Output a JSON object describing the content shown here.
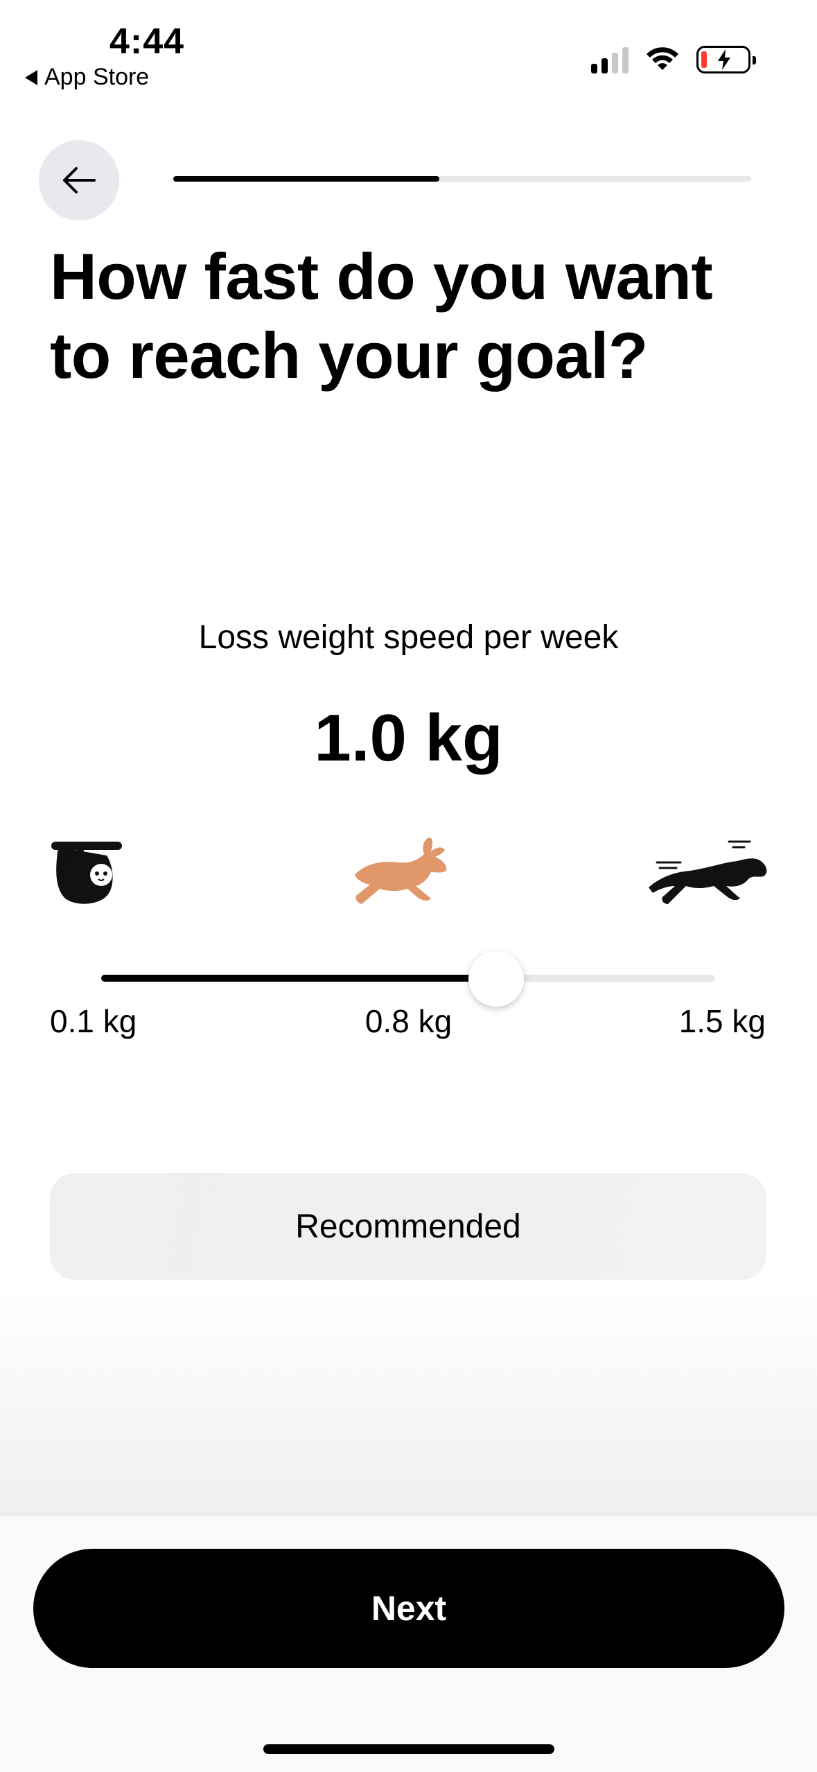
{
  "status_bar": {
    "time": "4:44",
    "back_app": "App Store",
    "battery_level_color": "#ff3b30"
  },
  "header": {
    "back_icon": "arrow-left-icon",
    "progress_fraction": 0.46
  },
  "question": {
    "title": "How fast do you want to reach your goal?",
    "subtitle": "Loss weight speed per week",
    "value": "1.0 kg"
  },
  "speed_slider": {
    "min": 0.1,
    "max": 1.5,
    "value": 1.0,
    "min_label": "0.1 kg",
    "mid_label": "0.8 kg",
    "max_label": "1.5 kg",
    "icons": [
      "sloth-icon",
      "rabbit-icon",
      "panther-icon"
    ],
    "highlight_color": "#e0976a"
  },
  "recommendation": {
    "label": "Recommended"
  },
  "footer": {
    "next_label": "Next"
  }
}
